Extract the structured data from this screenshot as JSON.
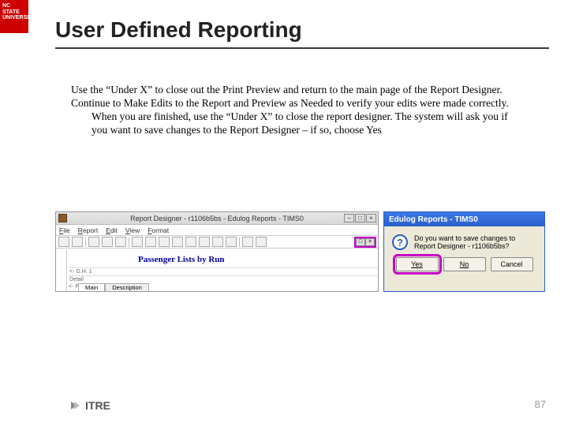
{
  "brand": {
    "line1": "NC STATE",
    "line2": "UNIVERSITY"
  },
  "title": "User Defined Reporting",
  "paragraphs": [
    "Use the “Under X” to close out the Print Preview and return to the main page of the Report Designer.",
    "Continue to Make Edits to the Report and Preview as Needed to verify your edits were made correctly. When you are finished, use the “Under X” to close the report designer. The system will ask you if you want to save changes to the Report Designer – if so, choose Yes"
  ],
  "designer": {
    "window_title": "Report Designer - r1106b5bs - Edulog Reports - TIMS0",
    "menus": [
      "File",
      "Report",
      "Edit",
      "View",
      "Format"
    ],
    "win_buttons": [
      "–",
      "□",
      "×"
    ],
    "under_x": [
      "□",
      "×"
    ],
    "report_heading": "Passenger Lists by Run",
    "bands": {
      "gh": "<- G.H. 1",
      "pf": "<- PageFooter",
      "det": "Detail"
    },
    "tabs": [
      "Main",
      "Description"
    ]
  },
  "dialog": {
    "title": "Edulog Reports - TIMS0",
    "message": "Do you want to save changes to Report Designer - r1106b5bs?",
    "buttons": {
      "yes": "Yes",
      "no": "No",
      "cancel": "Cancel"
    }
  },
  "footer": {
    "logo_text": "ITRE",
    "page": "87"
  }
}
